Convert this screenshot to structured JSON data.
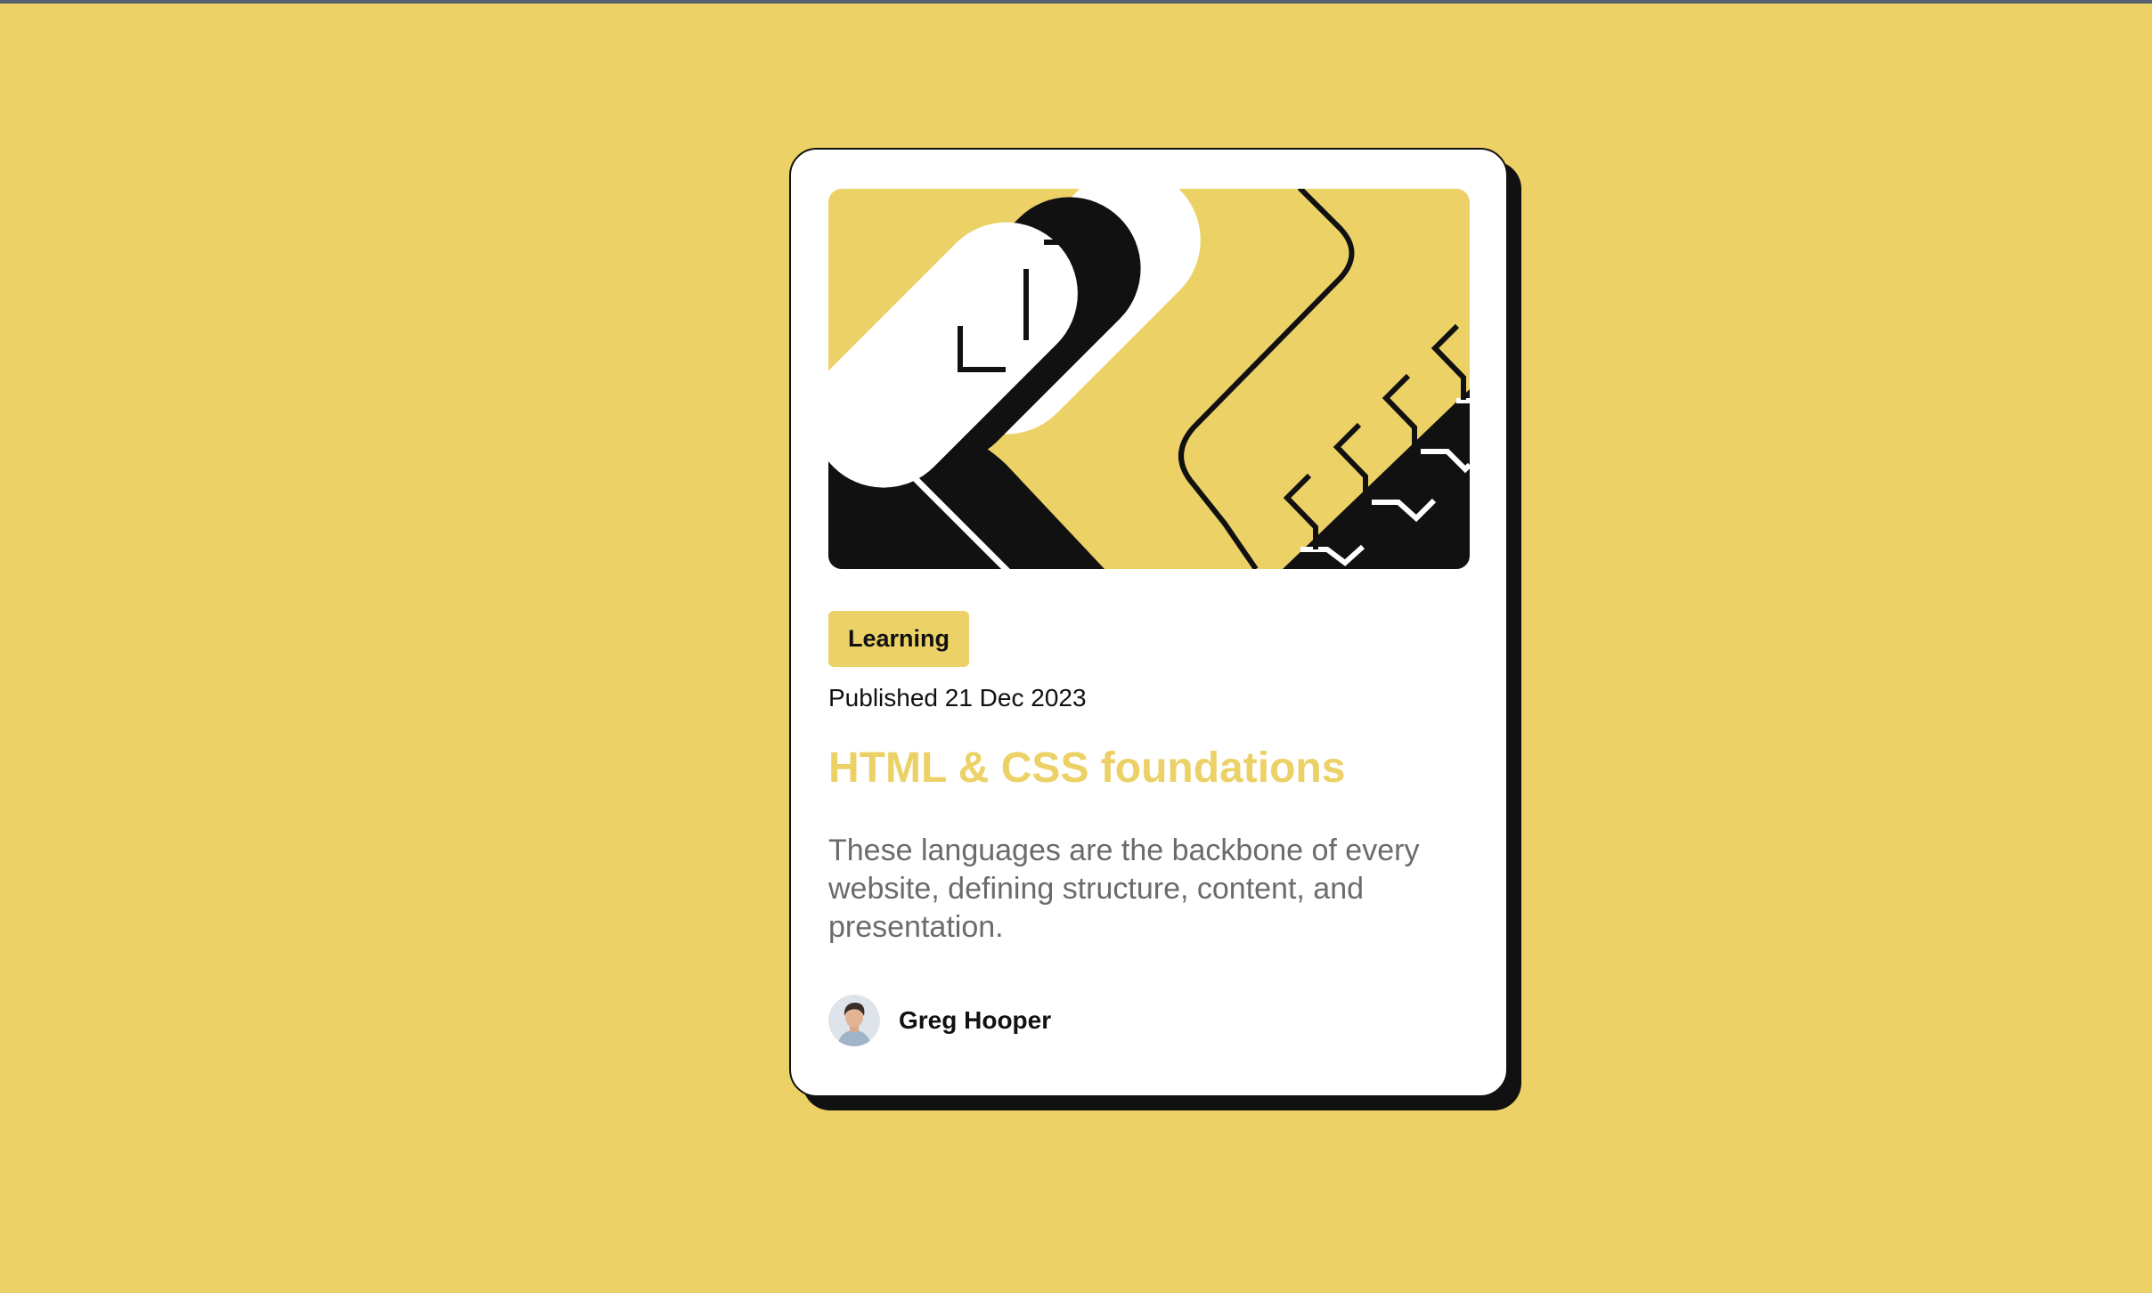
{
  "colors": {
    "background": "#ecd166",
    "card": "#ffffff",
    "ink": "#111111",
    "accent": "#ecd166",
    "muted_text": "#6b6b6b"
  },
  "card": {
    "illustration_icon": "abstract-yellow-black-illustration",
    "tag": "Learning",
    "published": "Published 21 Dec 2023",
    "title": "HTML & CSS foundations",
    "description": "These languages are the backbone of every website, defining structure, content, and presentation.",
    "author": {
      "avatar_icon": "author-avatar",
      "name": "Greg Hooper"
    }
  }
}
